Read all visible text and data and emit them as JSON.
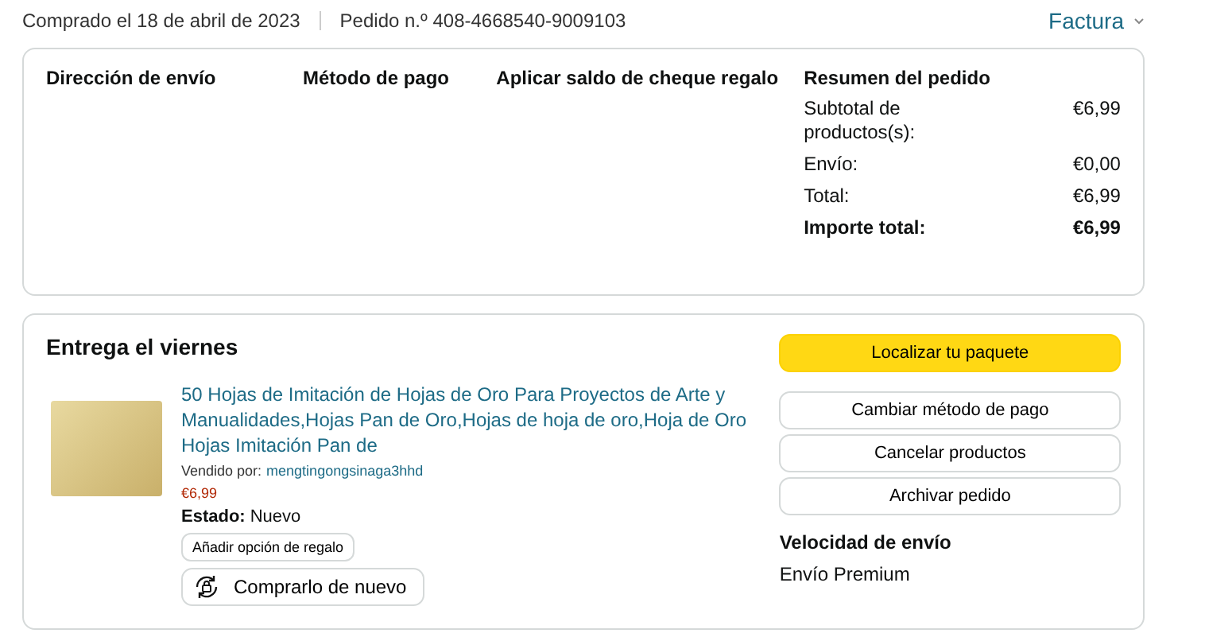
{
  "header": {
    "purchase_date": "Comprado el 18 de abril de 2023",
    "order_number": "Pedido n.º 408-4668540-9009103",
    "invoice_link": "Factura"
  },
  "details": {
    "columns": [
      "Dirección de envío",
      "Método de pago",
      "Aplicar saldo de cheque regalo"
    ],
    "summary": {
      "title": "Resumen del pedido",
      "rows": [
        {
          "label": "Subtotal de productos(s):",
          "value": "€6,99",
          "bold": false
        },
        {
          "label": "Envío:",
          "value": "€0,00",
          "bold": false
        },
        {
          "label": "Total:",
          "value": "€6,99",
          "bold": false
        },
        {
          "label": "Importe total:",
          "value": "€6,99",
          "bold": true
        }
      ]
    }
  },
  "delivery": {
    "title": "Entrega el viernes",
    "item": {
      "title": "50 Hojas de Imitación de Hojas de Oro Para Proyectos de Arte y Manualidades,Hojas Pan de Oro,Hojas de hoja de oro,Hoja de Oro Hojas Imitación Pan de",
      "seller_label": "Vendido por:",
      "seller": "mengtingongsinaga3hhd",
      "price": "€6,99",
      "condition_label": "Estado:",
      "condition": "Nuevo",
      "gift_button": "Añadir opción de regalo",
      "buy_again_button": "Comprarlo de nuevo"
    },
    "actions": [
      {
        "label": "Localizar tu paquete",
        "kind": "primary"
      },
      {
        "label": "Cambiar método de pago",
        "kind": "secondary"
      },
      {
        "label": "Cancelar productos",
        "kind": "secondary"
      },
      {
        "label": "Archivar pedido",
        "kind": "secondary"
      }
    ],
    "shipping_speed": {
      "title": "Velocidad de envío",
      "value": "Envío Premium"
    }
  }
}
